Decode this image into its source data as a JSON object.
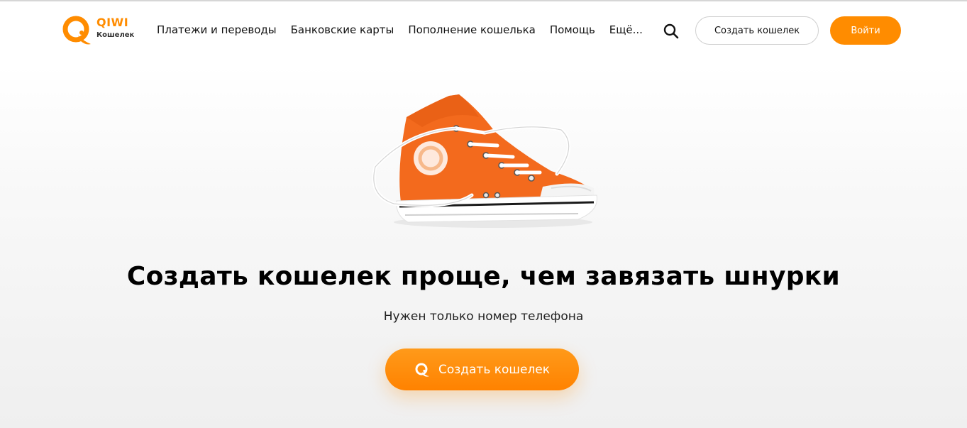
{
  "brand": {
    "name": "QIWI",
    "subtitle": "Кошелек",
    "accent_color": "#ff8c00"
  },
  "header": {
    "nav": [
      {
        "label": "Платежи и переводы"
      },
      {
        "label": "Банковские карты"
      },
      {
        "label": "Пополнение кошелька"
      },
      {
        "label": "Помощь"
      },
      {
        "label": "Ещё..."
      }
    ],
    "search_icon": "search-icon",
    "create_wallet_label": "Создать кошелек",
    "login_label": "Войти"
  },
  "hero": {
    "image": "orange-sneaker",
    "headline": "Создать кошелек проще, чем завязать шнурки",
    "subtitle": "Нужен только номер телефона",
    "cta_icon": "qiwi-logo-icon",
    "cta_label": "Создать кошелек"
  }
}
